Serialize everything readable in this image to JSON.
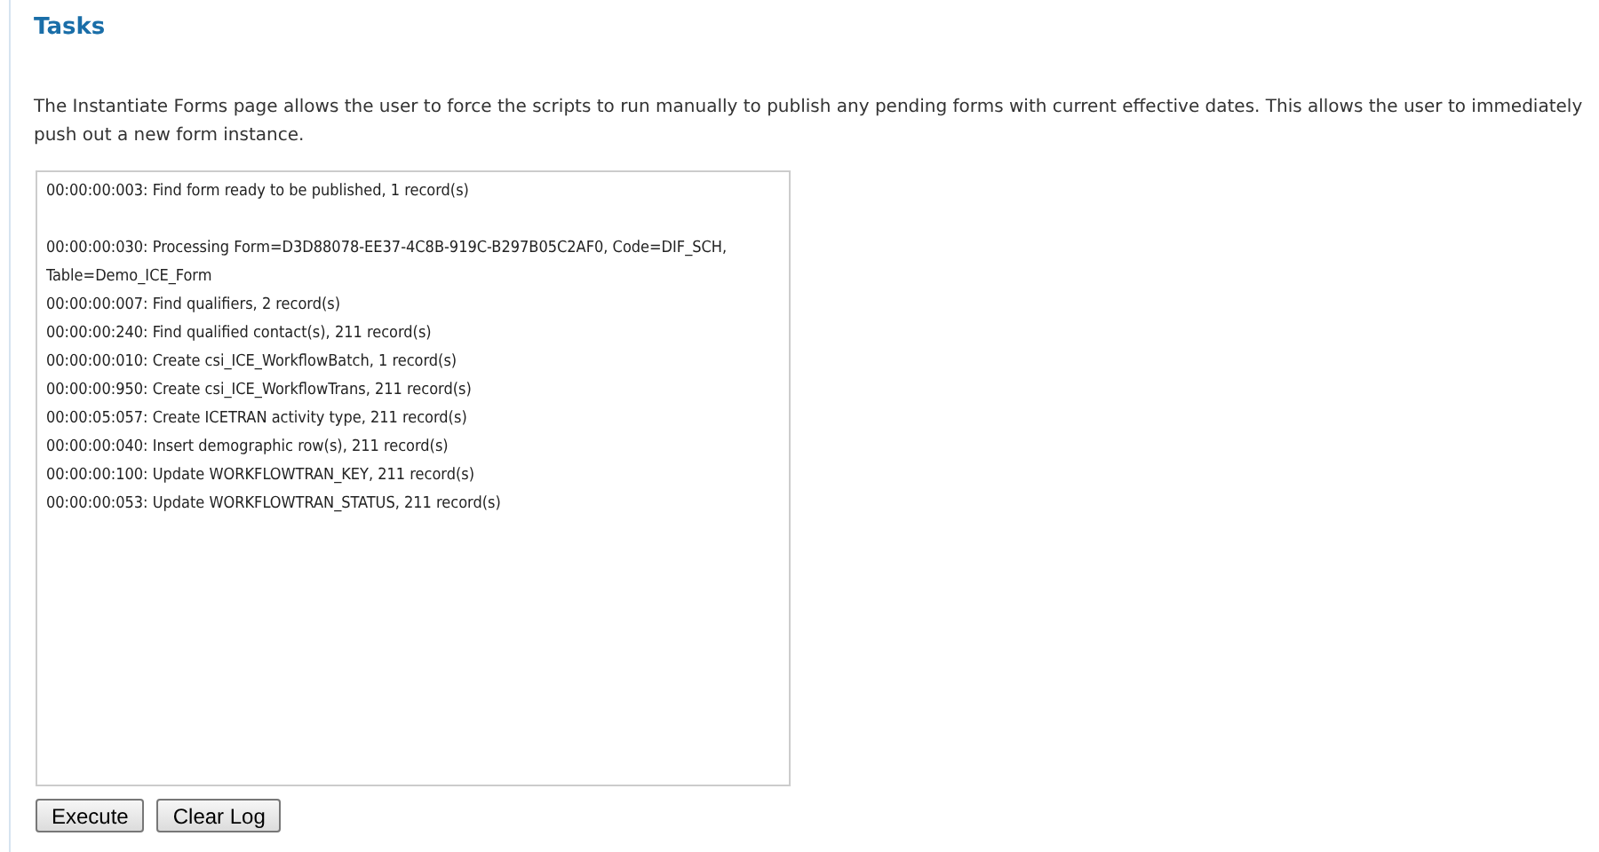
{
  "title": "Tasks",
  "description": "The Instantiate Forms page allows the user to force the scripts to run manually to publish any pending forms with current effective dates. This allows the user to immediately push out a new form instance.",
  "log_groups": [
    [
      "00:00:00:003: Find form ready to be published, 1 record(s)"
    ],
    [
      "00:00:00:030: Processing Form=D3D88078-EE37-4C8B-919C-B297B05C2AF0, Code=DIF_SCH, Table=Demo_ICE_Form",
      "00:00:00:007: Find qualifiers, 2 record(s)",
      "00:00:00:240: Find qualified contact(s), 211 record(s)",
      "00:00:00:010: Create csi_ICE_WorkflowBatch, 1 record(s)",
      "00:00:00:950: Create csi_ICE_WorkflowTrans, 211 record(s)",
      "00:00:05:057: Create ICETRAN activity type, 211 record(s)",
      "00:00:00:040: Insert demographic row(s), 211 record(s)",
      "00:00:00:100: Update WORKFLOWTRAN_KEY, 211 record(s)",
      "00:00:00:053: Update WORKFLOWTRAN_STATUS, 211 record(s)"
    ]
  ],
  "buttons": [
    "Execute",
    "Clear Log"
  ]
}
